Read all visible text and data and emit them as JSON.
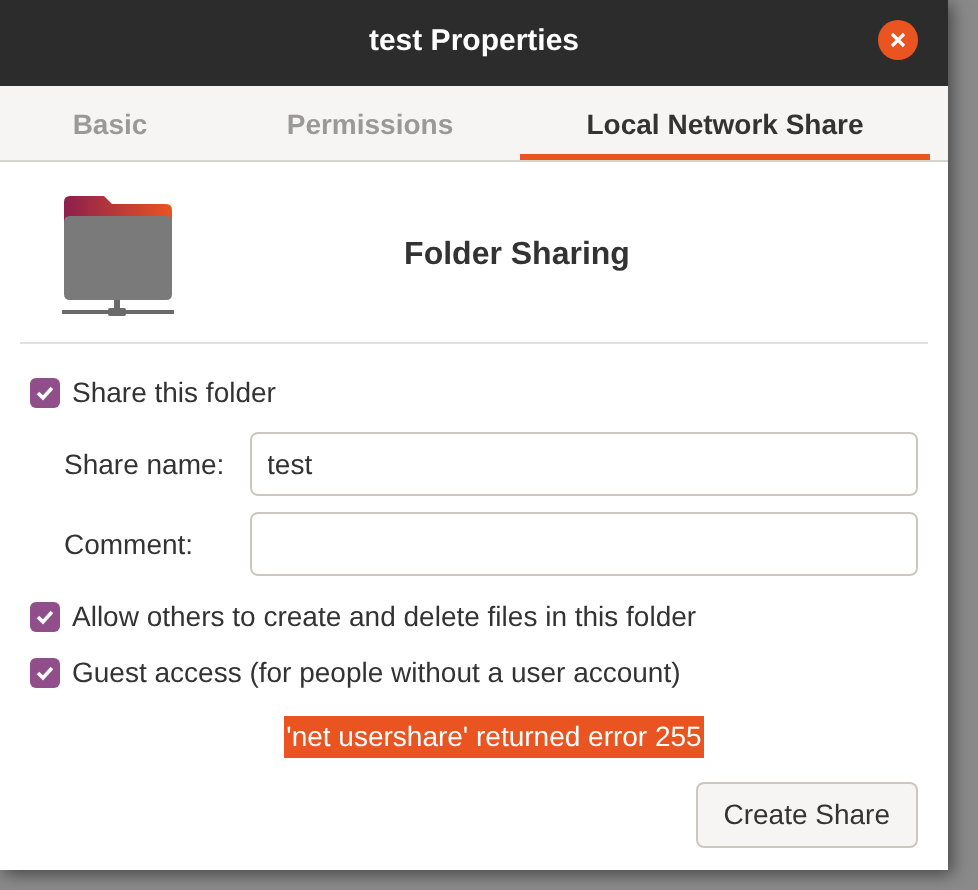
{
  "window": {
    "title": "test Properties"
  },
  "tabs": [
    {
      "label": "Basic",
      "selected": false
    },
    {
      "label": "Permissions",
      "selected": false
    },
    {
      "label": "Local Network Share",
      "selected": true
    }
  ],
  "header": {
    "title": "Folder Sharing"
  },
  "share_folder": {
    "label": "Share this folder",
    "checked": true
  },
  "fields": [
    {
      "label": "Share name:",
      "value": "test"
    },
    {
      "label": "Comment:"
    }
  ],
  "options": [
    {
      "label": "Allow others to create and delete files in this folder",
      "checked": true
    },
    {
      "label": "Guest access (for people without a user account)",
      "checked": true
    }
  ],
  "error": "'net usershare' returned error 255",
  "buttons": [
    "Create Share"
  ]
}
